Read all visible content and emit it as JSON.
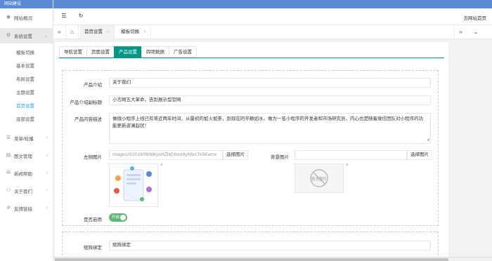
{
  "app": {
    "title": "网站建设",
    "home_link": "去网站首页"
  },
  "sidebar": {
    "items": [
      {
        "label": "网站概况",
        "icon": "eye-icon"
      },
      {
        "label": "系统设置",
        "icon": "gear-icon"
      },
      {
        "label": "菜单/轮播",
        "icon": "menu-icon"
      },
      {
        "label": "图文管理",
        "icon": "document-icon"
      },
      {
        "label": "新闻帮助",
        "icon": "chat-icon"
      },
      {
        "label": "关于我们",
        "icon": "user-group-icon"
      },
      {
        "label": "友情链接",
        "icon": "link-icon"
      }
    ],
    "subitems": [
      {
        "label": "模板切换"
      },
      {
        "label": "基本设置"
      },
      {
        "label": "布局设置"
      },
      {
        "label": "主题设置"
      },
      {
        "label": "首页设置"
      },
      {
        "label": "底部设置"
      }
    ]
  },
  "tabs": [
    {
      "label": "首页设置"
    },
    {
      "label": "模板切换"
    }
  ],
  "subtabs": [
    "导航设置",
    "页面设置",
    "产品设置",
    "四项数据",
    "广告设置"
  ],
  "form": {
    "product_intro": {
      "label": "产品介绍",
      "value": "关于我们"
    },
    "product_subtitle": {
      "label": "产品介绍副标题",
      "value": "小言网五大革命，告别展示型官网"
    },
    "product_desc": {
      "label": "产品内容描述",
      "value": "做微小程序上线已有将近两年时间，从最初的如火如荼，到现在的平静如水。做为一名小程序的开发者和市场研究员，内心也是随着微信团队对小程序的功能更新波澜起伏！"
    },
    "left_image": {
      "label": "左侧图片",
      "value": "images/0/2019/09/Mkyw6ZNC6nrk9yN6rcTk5Kwcw",
      "button": "选择图片"
    },
    "bg_image": {
      "label": "背景图片",
      "value": "",
      "button": "选择图片",
      "placeholder_text": "暂无图片"
    },
    "enabled": {
      "label": "是否启用",
      "toggle_text": "开启"
    },
    "matrix": {
      "label": "矩阵绑定",
      "value": "矩阵绑定"
    }
  },
  "colors": {
    "brand": "#5b8bd4",
    "accent": "#009688",
    "toggle": "#5fb878",
    "link": "#1e9fff"
  }
}
